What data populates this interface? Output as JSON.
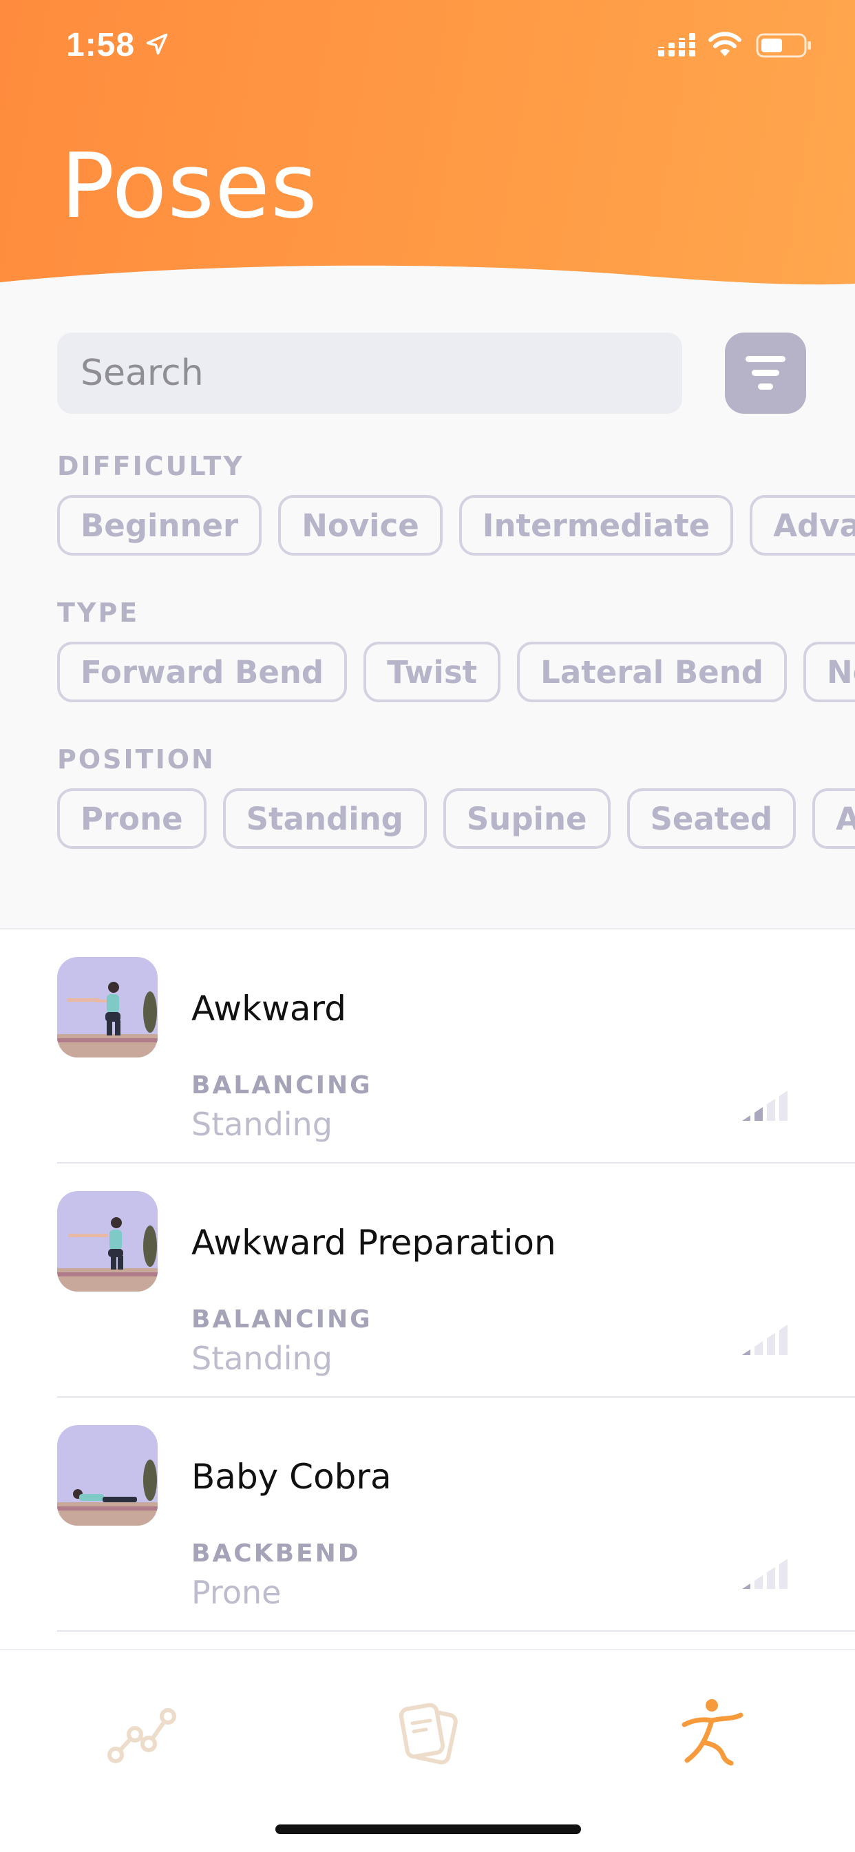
{
  "status_bar": {
    "time": "1:58"
  },
  "header": {
    "title": "Poses",
    "gradient_colors": [
      "#ff8c3e",
      "#ffa74e"
    ]
  },
  "search": {
    "placeholder": "Search"
  },
  "filters": {
    "difficulty": {
      "label": "DIFFICULTY",
      "chips": [
        "Beginner",
        "Novice",
        "Intermediate",
        "Advanced"
      ]
    },
    "type": {
      "label": "TYPE",
      "chips": [
        "Forward Bend",
        "Twist",
        "Lateral Bend",
        "Neutral"
      ]
    },
    "position": {
      "label": "POSITION",
      "chips": [
        "Prone",
        "Standing",
        "Supine",
        "Seated",
        "Arm & Leg Support"
      ]
    }
  },
  "poses": [
    {
      "name": "Awkward",
      "category": "BALANCING",
      "position": "Standing",
      "thumb": "squat"
    },
    {
      "name": "Awkward Preparation",
      "category": "BALANCING",
      "position": "Standing",
      "thumb": "squat"
    },
    {
      "name": "Baby Cobra",
      "category": "BACKBEND",
      "position": "Prone",
      "thumb": "prone"
    }
  ],
  "tabbar": {
    "tabs": [
      {
        "icon": "progress-chart-icon",
        "active": false
      },
      {
        "icon": "cards-icon",
        "active": false
      },
      {
        "icon": "yoga-pose-icon",
        "active": true
      }
    ],
    "active_color": "#f79a3c",
    "inactive_color": "#eedccb"
  }
}
